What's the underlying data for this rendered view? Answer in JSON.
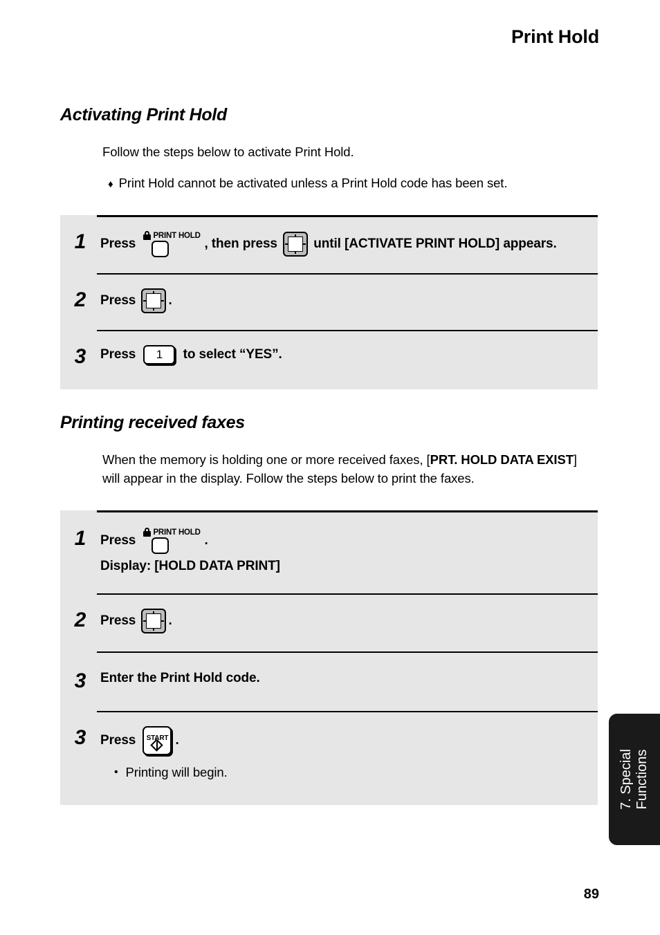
{
  "running_head": "Print Hold",
  "page_number": "89",
  "thumb_tab": "7. Special\nFunctions",
  "sections": {
    "activating": {
      "heading": "Activating Print Hold",
      "intro": "Follow the steps below to activate Print Hold.",
      "bullet_marker": "♦",
      "bullet": "Print Hold cannot be activated unless a Print Hold code has been set."
    },
    "printing": {
      "heading": "Printing received faxes",
      "intro_part1": "When the memory is holding one or more received faxes, [",
      "intro_bold": "PRT. HOLD DATA EXIST",
      "intro_part2": "]  will appear in the display. Follow the steps below to print the faxes."
    }
  },
  "keys": {
    "print_hold_label": "PRINT HOLD",
    "print_hold_icon": "lock-icon",
    "arrow_icon": "four-way-arrow-key-icon",
    "num_one": "1",
    "start_label": "START",
    "start_icon": "start-diamond-icon"
  },
  "steps_activating": [
    {
      "num": "1",
      "pre": "Press ",
      "mid": ", then press ",
      "post": " until [ACTIVATE PRINT HOLD] appears."
    },
    {
      "num": "2",
      "pre": "Press ",
      "post": "."
    },
    {
      "num": "3",
      "pre": "Press ",
      "post": " to select “YES”."
    }
  ],
  "steps_printing": [
    {
      "num": "1",
      "pre": "Press ",
      "post": ".",
      "display_line": "Display: [HOLD DATA PRINT]"
    },
    {
      "num": "2",
      "pre": "Press ",
      "post": "."
    },
    {
      "num": "3",
      "text": "Enter the Print Hold code."
    },
    {
      "num": "3",
      "pre": "Press ",
      "post": ".",
      "note_marker": "•",
      "note": "Printing will begin."
    }
  ]
}
